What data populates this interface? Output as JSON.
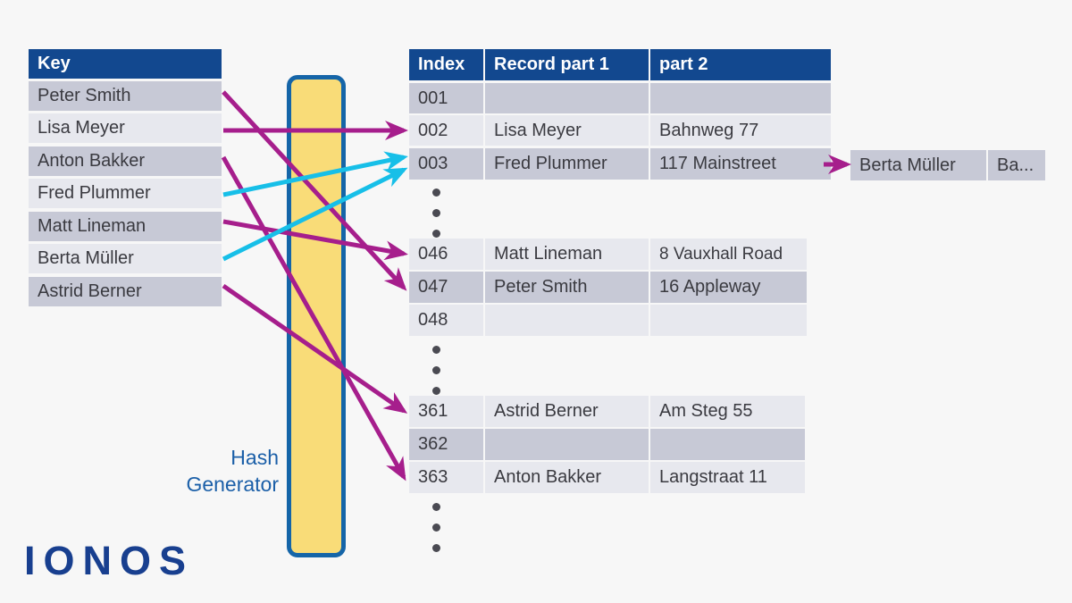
{
  "diagram": {
    "title": "Hash table with hash generator",
    "colors": {
      "header_blue": "#12488F",
      "row_dark": "#C7C9D6",
      "row_light": "#E7E8EE",
      "hash_yellow": "#F9DC78",
      "hash_border_blue": "#1565A8",
      "arrow_magenta": "#A61E8C",
      "arrow_cyan": "#17BFE8",
      "label_blue": "#1B5FA8",
      "logo_blue": "#183F8F",
      "background": "#F7F7F7"
    }
  },
  "key_table": {
    "header": "Key",
    "rows": [
      "Peter Smith",
      "Lisa Meyer",
      "Anton Bakker",
      "Fred Plummer",
      "Matt Lineman",
      "Berta Müller",
      "Astrid Berner"
    ]
  },
  "record_table": {
    "headers": {
      "index": "Index",
      "part1": "Record part 1",
      "part2": "part 2"
    },
    "groups": [
      {
        "rows": [
          {
            "index": "001",
            "part1": "",
            "part2": ""
          },
          {
            "index": "002",
            "part1": "Lisa Meyer",
            "part2": "Bahnweg 77"
          },
          {
            "index": "003",
            "part1": "Fred Plummer",
            "part2": "117 Mainstreet"
          }
        ]
      },
      {
        "rows": [
          {
            "index": "046",
            "part1": "Matt Lineman",
            "part2": "8 Vauxhall Road"
          },
          {
            "index": "047",
            "part1": "Peter Smith",
            "part2": "16 Appleway"
          },
          {
            "index": "048",
            "part1": "",
            "part2": ""
          }
        ]
      },
      {
        "rows": [
          {
            "index": "361",
            "part1": "Astrid Berner",
            "part2": "Am Steg 55"
          },
          {
            "index": "362",
            "part1": "",
            "part2": ""
          },
          {
            "index": "363",
            "part1": "Anton Bakker",
            "part2": "Langstraat 11"
          }
        ]
      }
    ]
  },
  "overflow_chain": {
    "part1": "Berta Müller",
    "part2": "Ba..."
  },
  "hash_generator": {
    "label_line1": "Hash",
    "label_line2": "Generator"
  },
  "logo": {
    "text": "IONOS"
  }
}
